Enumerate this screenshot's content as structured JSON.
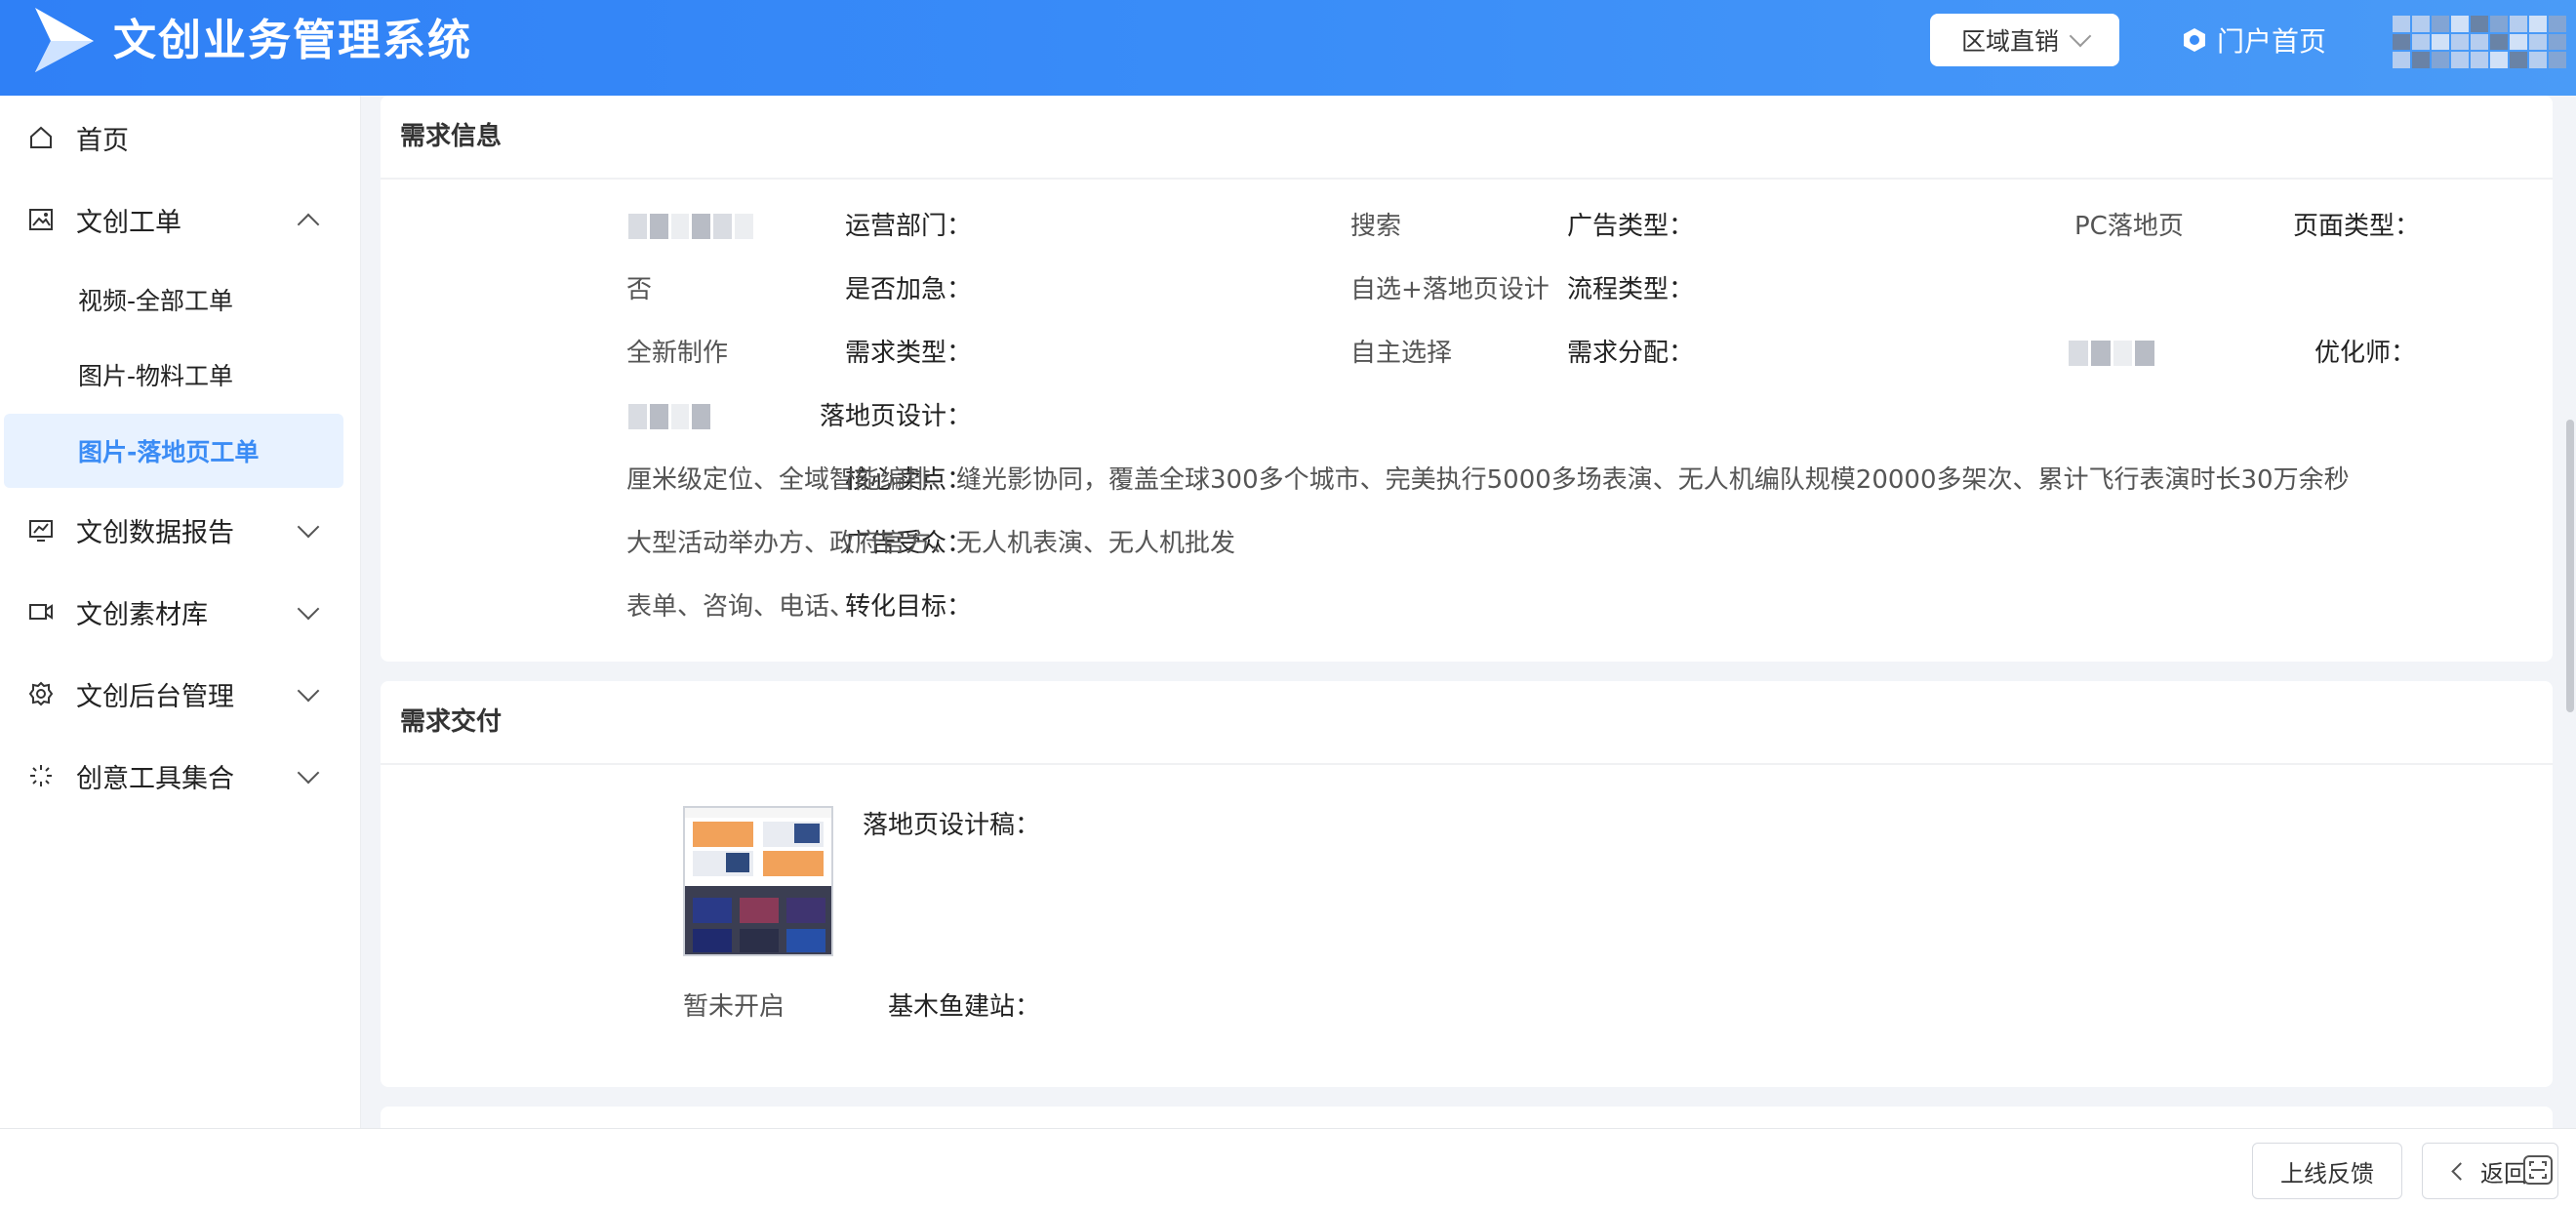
{
  "header": {
    "app_title": "文创业务管理系统",
    "region_button": "区域直销",
    "portal_link": "门户首页"
  },
  "sidebar": {
    "items": [
      {
        "label": "首页",
        "icon": "home-icon"
      },
      {
        "label": "文创工单",
        "icon": "image-icon",
        "expanded": true
      },
      {
        "label": "文创数据报告",
        "icon": "report-icon"
      },
      {
        "label": "文创素材库",
        "icon": "video-icon"
      },
      {
        "label": "文创后台管理",
        "icon": "gear-icon"
      },
      {
        "label": "创意工具集合",
        "icon": "sparkle-icon"
      }
    ],
    "sub_items": [
      {
        "label": "视频-全部工单"
      },
      {
        "label": "图片-物料工单"
      },
      {
        "label": "图片-落地页工单",
        "active": true
      }
    ]
  },
  "requirement_info": {
    "title": "需求信息",
    "fields": {
      "ops_dept": {
        "label": "运营部门："
      },
      "ad_type": {
        "label": "广告类型：",
        "value": "搜索"
      },
      "page_type": {
        "label": "页面类型：",
        "value": "PC落地页"
      },
      "urgent": {
        "label": "是否加急：",
        "value": "否"
      },
      "process_type": {
        "label": "流程类型：",
        "value": "自选+落地页设计"
      },
      "req_type": {
        "label": "需求类型：",
        "value": "全新制作"
      },
      "req_assign": {
        "label": "需求分配：",
        "value": "自主选择"
      },
      "optimizer": {
        "label": "优化师："
      },
      "landing_design": {
        "label": "落地页设计："
      },
      "selling_points": {
        "label": "核心卖点：",
        "value": "厘米级定位、全域智能编排、缝光影协同，覆盖全球300多个城市、完美执行5000多场表演、无人机编队规模20000多架次、累计飞行表演时长30万余秒"
      },
      "audience": {
        "label": "广告受众：",
        "value": "大型活动举办方、政府官方、无人机表演、无人机批发"
      },
      "conversion": {
        "label": "转化目标：",
        "value": "表单、咨询、电话、"
      }
    }
  },
  "requirement_delivery": {
    "title": "需求交付",
    "design_draft": {
      "label": "落地页设计稿："
    },
    "site_builder": {
      "label": "基木鱼建站：",
      "value": "暂未开启"
    }
  },
  "footer": {
    "feedback_button": "上线反馈",
    "back_button": "返回"
  },
  "colors": {
    "header_gradient_start": "#2f80f6",
    "header_gradient_end": "#4a9bf7",
    "accent": "#3b8cf5",
    "active_bg": "#e8f2ff",
    "page_bg": "#f2f4f8"
  }
}
